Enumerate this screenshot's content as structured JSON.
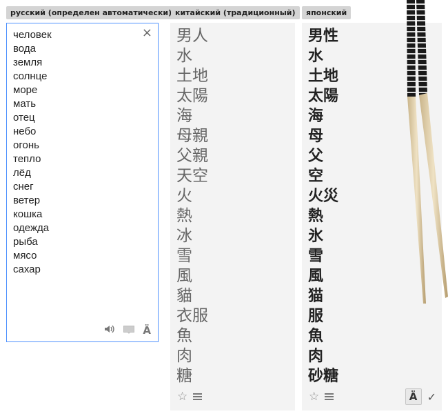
{
  "languages": {
    "source": "русский (определен автоматически)",
    "target1": "китайский (традиционный)",
    "target2": "японский"
  },
  "source_words": [
    "человек",
    "вода",
    "земля",
    "солнце",
    "море",
    "мать",
    "отец",
    "небо",
    "огонь",
    "тепло",
    "лёд",
    "снег",
    "ветер",
    "кошка",
    "одежда",
    "рыба",
    "мясо",
    "сахар"
  ],
  "zh_words": [
    "男人",
    "水",
    "土地",
    "太陽",
    "海",
    "母親",
    "父親",
    "天空",
    "火",
    "熱",
    "冰",
    "雪",
    "風",
    "貓",
    "衣服",
    "魚",
    "肉",
    "糖"
  ],
  "ja_words": [
    "男性",
    "水",
    "土地",
    "太陽",
    "海",
    "母",
    "父",
    "空",
    "火災",
    "熱",
    "氷",
    "雪",
    "風",
    "猫",
    "服",
    "魚",
    "肉",
    "砂糖"
  ],
  "icons": {
    "clear": "×",
    "speaker": "🔊",
    "keyboard": "▬",
    "font": "Ä",
    "star": "☆",
    "check": "✓"
  }
}
